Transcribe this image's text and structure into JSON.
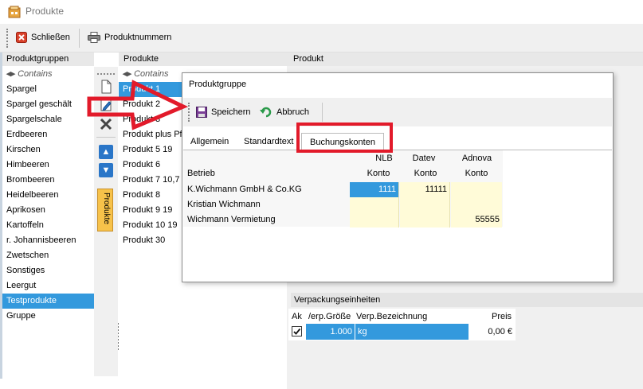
{
  "window": {
    "title": "Produkte"
  },
  "toolbar": {
    "close_label": "Schließen",
    "product_numbers_label": "Produktnummern"
  },
  "columns": {
    "groups": "Produktgruppen",
    "products": "Produkte",
    "product": "Produkt"
  },
  "contains_label": "Contains",
  "groups": [
    "Spargel",
    "Spargel geschält",
    "Spargelschale",
    "Erdbeeren",
    "Kirschen",
    "Himbeeren",
    "Brombeeren",
    "Heidelbeeren",
    "Aprikosen",
    "Kartoffeln",
    "r. Johannisbeeren",
    "Zwetschen",
    "Sonstiges",
    "Leergut",
    "Testprodukte",
    "Gruppe"
  ],
  "products": [
    "Produkt 1",
    "Produkt 2",
    "Produkt 3",
    "Produkt plus Pfa",
    "Produkt 5 19",
    "Produkt 6",
    "Produkt 7 10,7",
    "Produkt 8",
    "Produkt 9 19",
    "Produkt 10 19",
    "Produkt 30"
  ],
  "vertical_tab": "Produkte",
  "dialog": {
    "title": "Produktgruppe",
    "save_label": "Speichern",
    "cancel_label": "Abbruch",
    "tabs": [
      "Allgemein",
      "Standardtext",
      "Buchungskonten"
    ],
    "grid": {
      "col_betrieb": "Betrieb",
      "col_nlb": "NLB",
      "col_datev": "Datev",
      "col_adnova": "Adnova",
      "konto": "Konto",
      "rows": [
        {
          "betrieb": "K.Wichmann GmbH & Co.KG",
          "nlb": "1111",
          "datev": "11111",
          "adnova": ""
        },
        {
          "betrieb": "Kristian Wichmann",
          "nlb": "",
          "datev": "",
          "adnova": ""
        },
        {
          "betrieb": "Wichmann Vermietung",
          "nlb": "",
          "datev": "",
          "adnova": "55555"
        }
      ]
    }
  },
  "packaging": {
    "title": "Verpackungseinheiten",
    "col_ak": "Ak",
    "col_size": "/erp.Größe",
    "col_name": "Verp.Bezeichnung",
    "col_price": "Preis",
    "row": {
      "size": "1.000",
      "name": "kg",
      "price": "0,00 €"
    }
  },
  "colors": {
    "selection": "#3399dd",
    "annotation": "#e21a2a",
    "vtab": "#f7c24a"
  }
}
